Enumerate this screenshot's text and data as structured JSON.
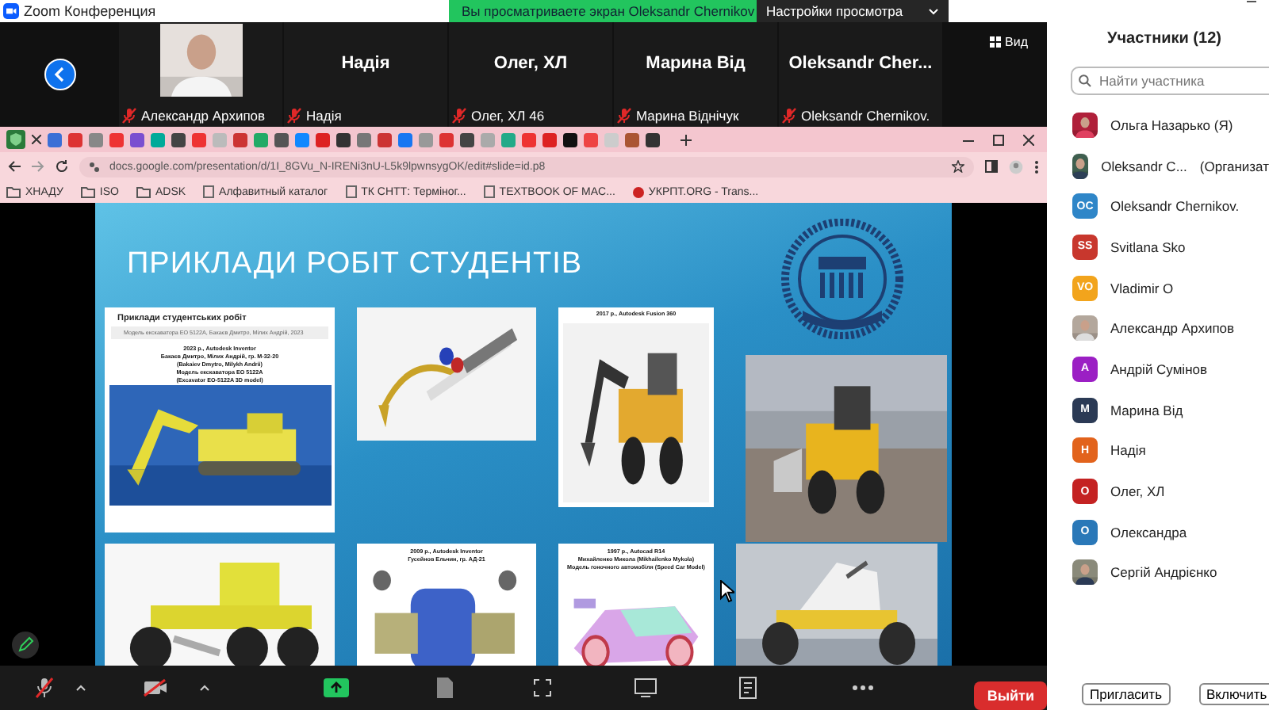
{
  "window": {
    "title": "Zoom Конференция"
  },
  "share_banner": {
    "text": "Вы просматриваете экран Oleksandr Chernikov",
    "view_settings": "Настройки просмотра"
  },
  "gallery": {
    "view_button": "Вид",
    "tiles": [
      {
        "kind": "video",
        "name": "Александр Архипов",
        "muted": true
      },
      {
        "kind": "name",
        "display_name": "Надія",
        "name": "Надія",
        "muted": true
      },
      {
        "kind": "name",
        "display_name": "Олег, ХЛ",
        "name": "Олег, ХЛ 46",
        "muted": true
      },
      {
        "kind": "name",
        "display_name": "Марина Від",
        "name": "Марина Віднічук",
        "muted": true
      },
      {
        "kind": "name",
        "display_name": "Oleksandr  Cher...",
        "name": "Oleksandr Chernikov.",
        "muted": true
      }
    ]
  },
  "browser": {
    "url": "docs.google.com/presentation/d/1I_8GVu_N-IRENi3nU-L5k9lpwnsygOK/edit#slide=id.p8",
    "bookmarks": [
      {
        "kind": "folder",
        "label": "ХНАДУ"
      },
      {
        "kind": "folder",
        "label": "ISO"
      },
      {
        "kind": "folder",
        "label": "ADSK"
      },
      {
        "kind": "page",
        "label": "Алфавитный каталог"
      },
      {
        "kind": "page",
        "label": "ТК СНТТ: Терміног..."
      },
      {
        "kind": "page",
        "label": "TEXTBOOK OF MAC..."
      },
      {
        "kind": "dot",
        "label": "УКРПТ.ORG - Trans..."
      }
    ]
  },
  "slide": {
    "title": "ПРИКЛАДИ РОБІТ СТУДЕНТІВ",
    "cards": [
      {
        "kind": "document",
        "heading": "Приклади студентських робіт",
        "subheading": "Модель екскаватора ЕО 5122А, Бакаєв Дмитро, Мілих Андрій, 2023",
        "caption": [
          "2023 р., Autodesk Inventor",
          "Бакаєв Дмитро, Мілих Андрій, гр. М-32-20",
          "(Bakaiev Dmytro, Milykh Andrii)",
          "Модель екскаватора ЕО 5122А",
          "(Excavator EO-5122A 3D model)"
        ]
      },
      {
        "kind": "picture"
      },
      {
        "kind": "captioned",
        "caption": [
          "2017 р., Autodesk Fusion 360"
        ]
      },
      {
        "kind": "picture"
      },
      {
        "kind": "picture"
      },
      {
        "kind": "captioned",
        "caption": [
          "2009 р., Autodesk Inventor",
          "Гусейнов Ельчин, гр. АД-21"
        ]
      },
      {
        "kind": "captioned",
        "caption": [
          "1997 р., Autocad R14",
          "Михайленко Микола (Mikhailenko Mykola)",
          "Модель гоночного автомобіля (Speed Car Model)"
        ]
      },
      {
        "kind": "picture"
      }
    ]
  },
  "participants": {
    "title": "Участники (12)",
    "search": {
      "placeholder": "Найти участника"
    },
    "items": [
      {
        "name": "Ольга Назарько (Я)"
      },
      {
        "name": "Oleksandr C...",
        "role": "(Организат"
      },
      {
        "kind": "initials",
        "initials": "OC",
        "color": "#2f86c8",
        "name": "Oleksandr Chernikov."
      },
      {
        "kind": "initials",
        "initials": "SS",
        "color": "#c8372d",
        "name": "Svitlana Sko"
      },
      {
        "kind": "initials",
        "initials": "VO",
        "color": "#f2a41c",
        "name": "Vladimir O"
      },
      {
        "name": "Александр Архипов"
      },
      {
        "kind": "initials",
        "initials": "A",
        "color": "#9b1fc4",
        "name": "Андрій Сумінов"
      },
      {
        "kind": "initials",
        "initials": "M",
        "color": "#2b3a55",
        "name": "Марина Від"
      },
      {
        "kind": "initials",
        "initials": "H",
        "color": "#e2631c",
        "name": "Надія"
      },
      {
        "kind": "initials",
        "initials": "O",
        "color": "#c42222",
        "name": "Олег, ХЛ"
      },
      {
        "kind": "initials",
        "initials": "O",
        "color": "#2a78b8",
        "name": "Олександра"
      },
      {
        "name": "Сергій Андрієнко"
      }
    ],
    "buttons": [
      "Пригласить",
      "Включить"
    ]
  },
  "toolbar": {
    "mic_muted": true,
    "video_off": true,
    "leave": "Выйти"
  }
}
